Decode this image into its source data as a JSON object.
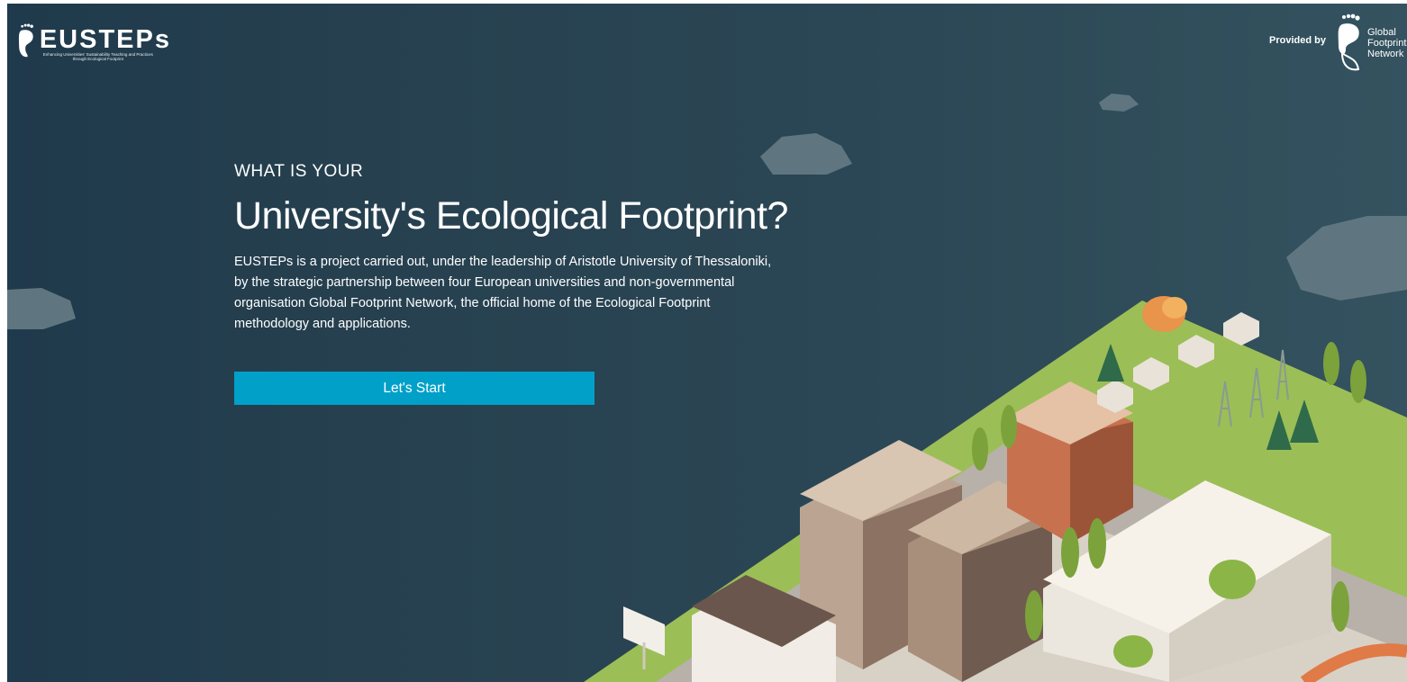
{
  "header": {
    "brand_name": "EUSTEPs",
    "brand_tagline": "Enhancing Universities' Sustainability Teaching and Practices through Ecological Footprint",
    "provided_by_label": "Provided by",
    "provider_name_lines": [
      "Global",
      "Footprint",
      "Network"
    ]
  },
  "hero": {
    "eyebrow": "WHAT IS YOUR",
    "headline": "University's Ecological Footprint?",
    "intro": "EUSTEPs is a project carried out, under the leadership of Aristotle University of Thessaloniki, by the strategic partnership between four European universities and non-governmental organisation Global Footprint Network, the official home of the Ecological Footprint methodology and applications.",
    "cta_label": "Let's Start"
  },
  "illustration": {
    "subject": "isometric-city-campus-icon"
  },
  "colors": {
    "background": "#26404f",
    "cta": "#00a0c9",
    "grass": "#a6c65a",
    "text": "#ffffff"
  }
}
